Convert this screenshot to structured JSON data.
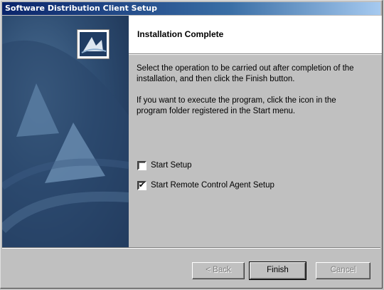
{
  "window": {
    "title": "Software Distribution Client Setup"
  },
  "header": {
    "title": "Installation Complete"
  },
  "body": {
    "paragraph1": "Select the operation to be carried out after completion of the installation, and then click the Finish button.",
    "paragraph2": "If you want to execute the program, click the icon in the program folder registered in the Start menu."
  },
  "options": [
    {
      "label": "Start Setup",
      "checked": false,
      "mark": ""
    },
    {
      "label": "Start Remote Control Agent Setup",
      "checked": true,
      "mark": "✔"
    }
  ],
  "buttons": {
    "back": "< Back",
    "finish": "Finish",
    "cancel": "Cancel"
  },
  "colors": {
    "titlebar": "#0a246a",
    "side_panel": "#2e4d72",
    "face": "#c0c0c0"
  }
}
